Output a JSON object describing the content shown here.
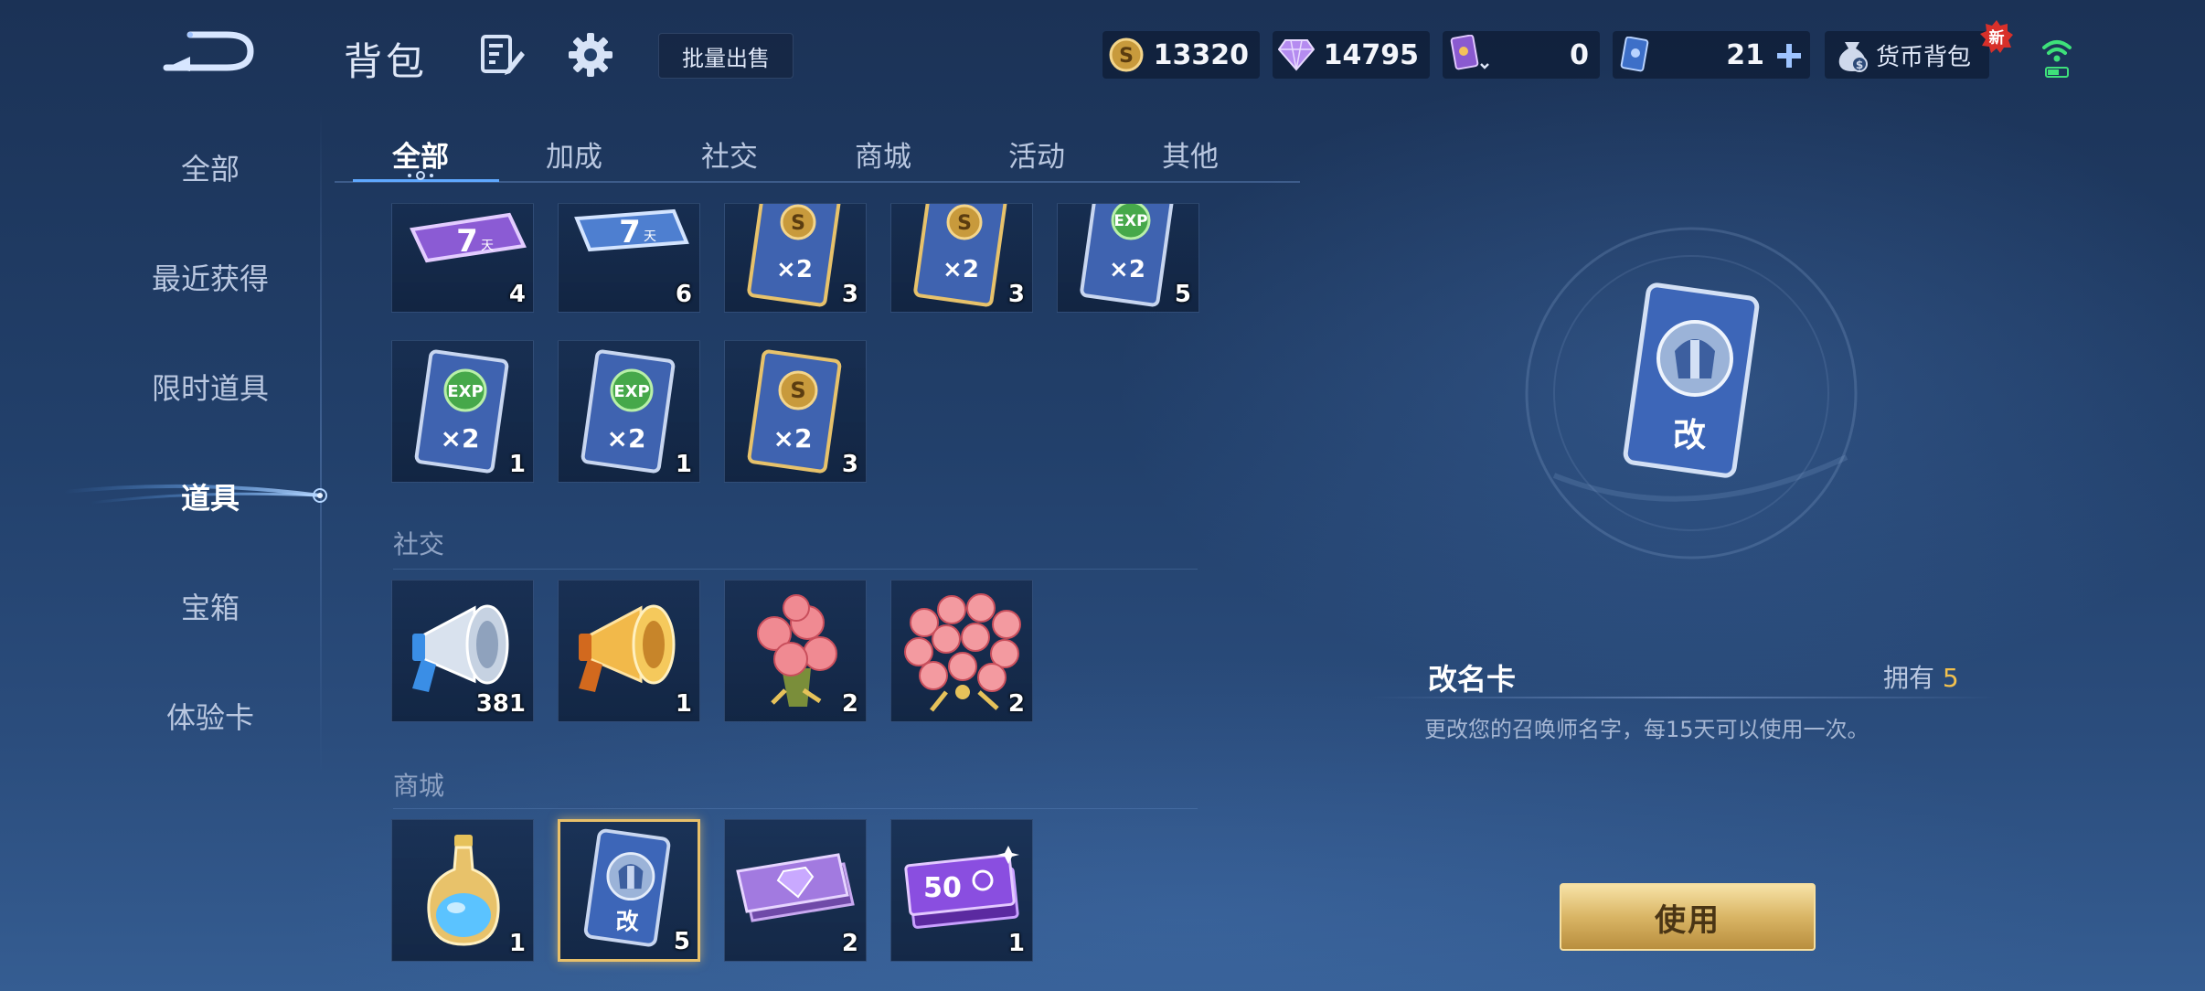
{
  "header": {
    "title": "背包",
    "batch_sell": "批量出售",
    "currencies": [
      {
        "icon": "gold-coin-icon",
        "value": "13320"
      },
      {
        "icon": "diamond-icon",
        "value": "14795"
      },
      {
        "icon": "purple-card-icon",
        "value": "0"
      },
      {
        "icon": "blue-ticket-icon",
        "value": "21"
      }
    ],
    "currency_bag": "货币背包",
    "new_badge": "新"
  },
  "nav": {
    "items": [
      {
        "label": "全部"
      },
      {
        "label": "最近获得"
      },
      {
        "label": "限时道具"
      },
      {
        "label": "道具",
        "active": true
      },
      {
        "label": "宝箱"
      },
      {
        "label": "体验卡"
      }
    ]
  },
  "tabs": [
    {
      "label": "全部",
      "active": true
    },
    {
      "label": "加成"
    },
    {
      "label": "社交"
    },
    {
      "label": "商城"
    },
    {
      "label": "活动"
    },
    {
      "label": "其他"
    }
  ],
  "sections": {
    "bonus": {
      "items": [
        {
          "icon": "purple-7day-card-icon",
          "count": "4"
        },
        {
          "icon": "blue-7day-card-icon",
          "count": "6"
        },
        {
          "icon": "gold-double-card-icon",
          "count": "3"
        },
        {
          "icon": "gold-double-card-icon",
          "count": "3"
        },
        {
          "icon": "exp-double-card-icon",
          "count": "5"
        },
        {
          "icon": "exp-double-card-icon",
          "count": "1"
        },
        {
          "icon": "exp-double-card-icon",
          "count": "1"
        },
        {
          "icon": "gold-double-card-icon",
          "count": "3"
        }
      ]
    },
    "social": {
      "title": "社交",
      "items": [
        {
          "icon": "silver-horn-icon",
          "count": "381"
        },
        {
          "icon": "gold-horn-icon",
          "count": "1"
        },
        {
          "icon": "rose-bouquet-icon",
          "count": "2"
        },
        {
          "icon": "large-rose-bouquet-icon",
          "count": "2"
        }
      ]
    },
    "shop": {
      "title": "商城",
      "items": [
        {
          "icon": "potion-bottle-icon",
          "count": "1"
        },
        {
          "icon": "rename-card-icon",
          "count": "5",
          "selected": true
        },
        {
          "icon": "diamond-ticket-icon",
          "count": "2"
        },
        {
          "icon": "voucher-50-icon",
          "count": "1",
          "label": "50"
        }
      ]
    }
  },
  "detail": {
    "card_char": "改",
    "name": "改名卡",
    "own_label": "拥有",
    "own_count": "5",
    "description": "更改您的召唤师名字，每15天可以使用一次。",
    "use_button": "使用"
  },
  "card_badges": {
    "seven": "7",
    "day": "天",
    "x2": "×2",
    "s": "S",
    "exp": "EXP"
  },
  "colors": {
    "accent_gold": "#f2c14e",
    "button_gold": "#d9b565",
    "bg_dark": "#1b3256"
  }
}
